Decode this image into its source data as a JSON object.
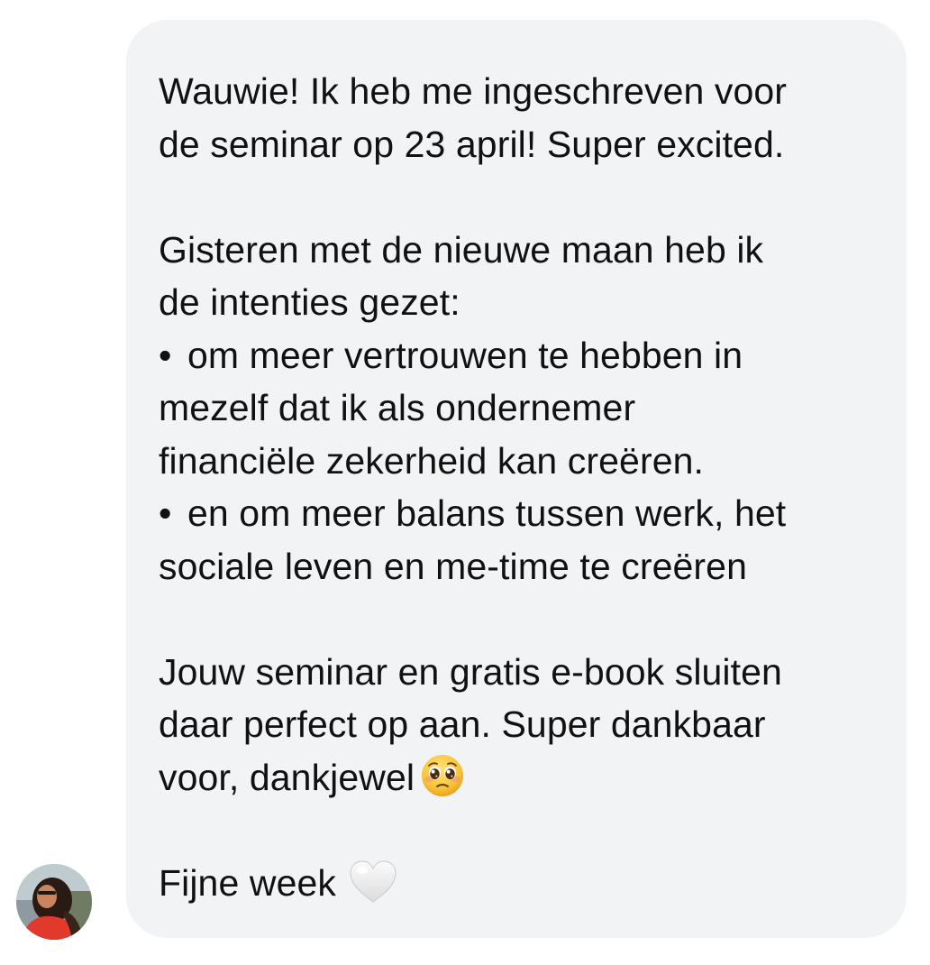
{
  "message": {
    "p1": [
      "Wauwie! Ik heb me ingeschreven voor",
      "de seminar op 23 april! Super excited."
    ],
    "p2": {
      "intro": [
        "Gisteren met de nieuwe maan heb ik",
        "de intenties gezet:"
      ],
      "bullet_symbol": "•",
      "bullet1": [
        "om meer vertrouwen te hebben in",
        "mezelf dat ik als ondernemer",
        "financiële zekerheid kan creëren."
      ],
      "bullet2": [
        "en om meer balans tussen werk, het",
        "sociale leven en me-time te creëren"
      ]
    },
    "p3": [
      "Jouw seminar en gratis e-book sluiten",
      "daar perfect op aan. Super dankbaar",
      "voor, dankjewel"
    ],
    "p4": "Fijne week",
    "emoji": {
      "face": "pleading-face-icon",
      "heart": "white-heart-icon"
    }
  },
  "colors": {
    "bubble_bg": "#f2f3f5",
    "text": "#111111"
  }
}
